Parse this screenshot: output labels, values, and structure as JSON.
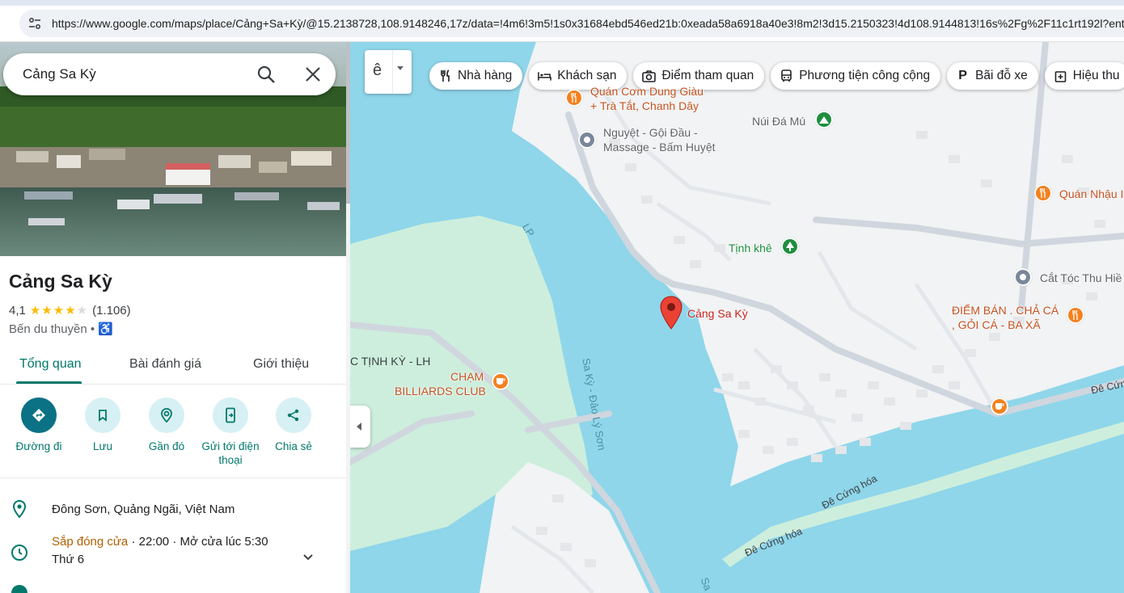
{
  "browser": {
    "url": "https://www.google.com/maps/place/Cảng+Sa+Kỳ/@15.2138728,108.9148246,17z/data=!4m6!3m5!1s0x31684ebd546ed21b:0xeada58a6918a40e3!8m2!3d15.2150323!4d108.9144813!16s%2Fg%2F11c1rt192l?entry=tt"
  },
  "search": {
    "query": "Cảng Sa Kỳ"
  },
  "place": {
    "name": "Cảng Sa Kỳ",
    "rating": "4,1",
    "stars": 4.1,
    "reviews": "(1.106)",
    "category": "Bến du thuyền",
    "category_sep": "•"
  },
  "tabs": [
    {
      "label": "Tổng quan"
    },
    {
      "label": "Bài đánh giá"
    },
    {
      "label": "Giới thiệu"
    }
  ],
  "actions": [
    {
      "label": "Đường đi",
      "icon": "directions-icon"
    },
    {
      "label": "Lưu",
      "icon": "bookmark-icon"
    },
    {
      "label": "Gần đó",
      "icon": "nearby-icon"
    },
    {
      "label": "Gửi tới điện thoại",
      "icon": "send-to-phone-icon"
    },
    {
      "label": "Chia sẻ",
      "icon": "share-icon"
    }
  ],
  "info": {
    "address": "Đông Sơn, Quảng Ngãi, Việt Nam",
    "hours_status": "Sắp đóng cửa",
    "hours_detail": " · 22:00 · Mở cửa lúc 5:30",
    "hours_day": "Thứ 6"
  },
  "map": {
    "layer_button": "ê",
    "chips": [
      {
        "label": "Nhà hàng",
        "icon": "fork-knife-icon"
      },
      {
        "label": "Khách sạn",
        "icon": "bed-icon"
      },
      {
        "label": "Điểm tham quan",
        "icon": "camera-icon"
      },
      {
        "label": "Phương tiện công cộng",
        "icon": "bus-icon"
      },
      {
        "label": "Bãi đỗ xe",
        "icon": "parking-icon"
      },
      {
        "label": "Hiệu thu",
        "icon": "pharmacy-icon"
      }
    ],
    "labels": {
      "quan_com_1": "Quán Cơm Dung Giàu",
      "quan_com_2": "+ Trà Tắt, Chanh Dây",
      "nui_da_mu": "Núi Đá Mú",
      "nguyet_1": "Nguyệt - Gội Đầu -",
      "nguyet_2": "Massage - Bấm Huyệt",
      "quan_nhau": "Quán Nhậu I",
      "tinh_khe": "Tịnh khê",
      "cat_toc": "Cắt Tóc Thu Hiề",
      "cang_sa_ky": "Cảng Sa Kỳ",
      "diem_ban_1": "ĐIỂM BÁN . CHẢ CÁ",
      "diem_ban_2": ", GỎI CÁ - BA XÃ",
      "lp": "LP",
      "sa_ky_road": "Sa Kỳ - Đảo Lý Sơn",
      "tinh_ky": "C TỊNH KỲ - LH",
      "cham_1": "CHẠM",
      "cham_2": "BILLIARDS CLUB",
      "de_cung_hoa_1": "Đê Cứng hóa",
      "de_cung_hoa_2": "Đê Cứng hóa",
      "de_cung_hoa_3": "Đê Cứng hóa",
      "de_cung_4": "Đê Cứn",
      "sa_bottom": "Sa"
    }
  },
  "colors": {
    "accent": "#00796b",
    "water": "#8fd6ea",
    "park": "#cdeedd",
    "pin": "#ea4335"
  }
}
